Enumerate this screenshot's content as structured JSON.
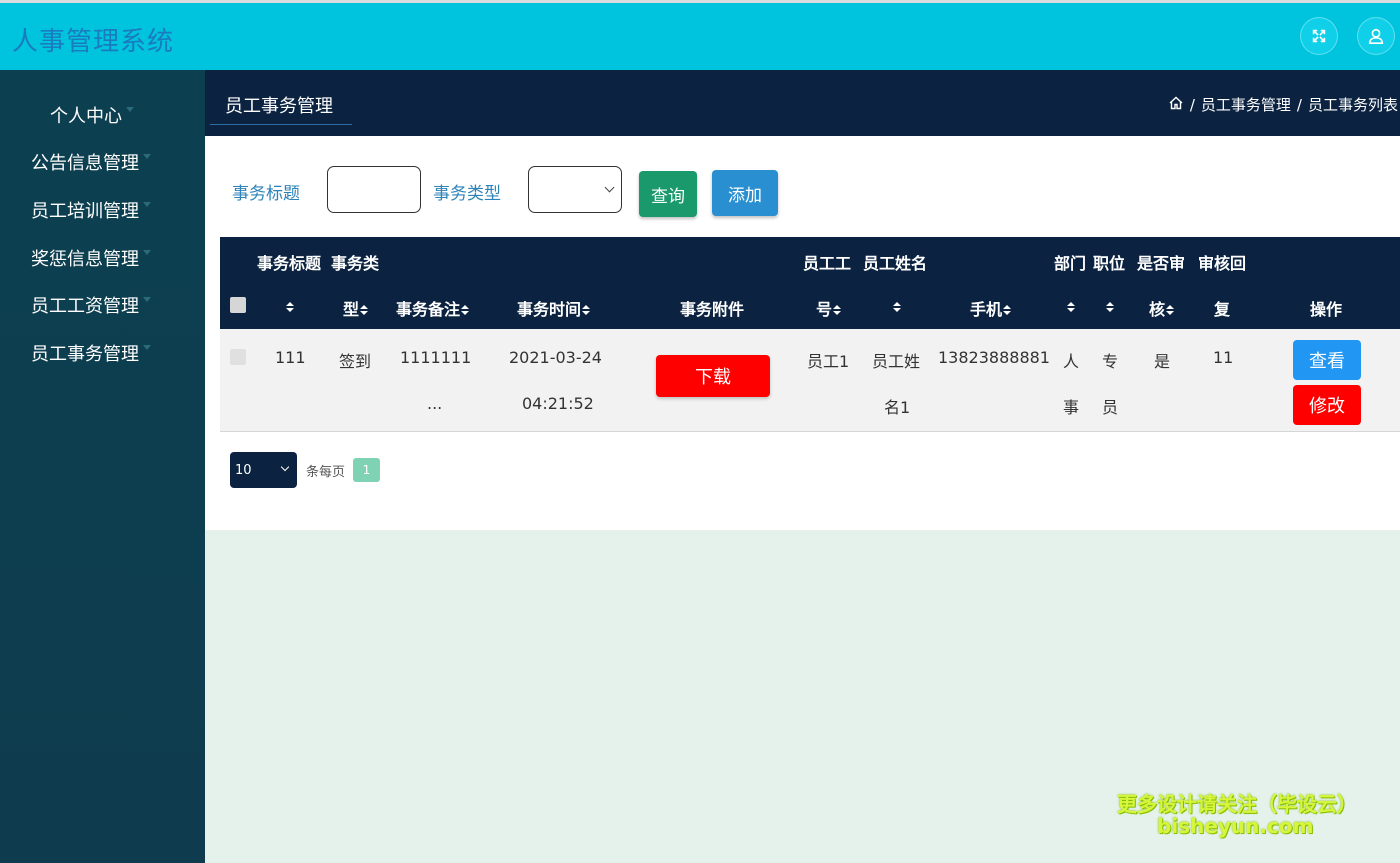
{
  "app": {
    "title": "人事管理系统"
  },
  "header_icons": [
    "fullscreen-icon",
    "user-icon"
  ],
  "sidebar": {
    "items": [
      {
        "label": "个人中心"
      },
      {
        "label": "公告信息管理"
      },
      {
        "label": "员工培训管理"
      },
      {
        "label": "奖惩信息管理"
      },
      {
        "label": "员工工资管理"
      },
      {
        "label": "员工事务管理"
      }
    ]
  },
  "page": {
    "title": "员工事务管理",
    "breadcrumb": [
      "员工事务管理",
      "员工事务列表"
    ],
    "breadcrumb_sep": "/"
  },
  "search": {
    "title_label": "事务标题",
    "title_value": "",
    "type_label": "事务类型",
    "type_value": "",
    "query_label": "查询",
    "add_label": "添加"
  },
  "table": {
    "headers": {
      "title_l1": "事务标题",
      "type_l1": "事务类",
      "type_l2": "型",
      "remark": "事务备注",
      "time": "事务时间",
      "attachment": "事务附件",
      "empno_l1": "员工工",
      "empno_l2": "号",
      "empname_l1": "员工姓名",
      "phone": "手机",
      "dept_l1": "部门",
      "pos_l1": "职位",
      "audit_l1": "是否审",
      "audit_l2": "核",
      "reply_l1": "审核回",
      "reply_l2": "复",
      "ops": "操作"
    },
    "rows": [
      {
        "title": "111",
        "type": "签到",
        "remark_l1": "1111111",
        "remark_l2": "...",
        "time_l1": "2021-03-24",
        "time_l2": "04:21:52",
        "attachment_btn": "下载",
        "empno": "员工1",
        "empname_l1": "员工姓",
        "empname_l2": "名1",
        "phone": "13823888881",
        "dept_l1": "人",
        "dept_l2": "事",
        "pos_l1": "专",
        "pos_l2": "员",
        "audit": "是",
        "reply": "11",
        "view_btn": "查看",
        "edit_btn": "修改"
      }
    ]
  },
  "pagination": {
    "page_size": "10",
    "per_page_label": "条每页",
    "current_page": "1"
  },
  "watermark": {
    "line1": "更多设计请关注（毕设云）",
    "line2": "bisheyun.com"
  },
  "colors": {
    "topbar": "#00c4dd",
    "sidebar": "#0e3c4e",
    "navy": "#0b2340",
    "danger": "#ff0000",
    "primary": "#2196f3"
  }
}
